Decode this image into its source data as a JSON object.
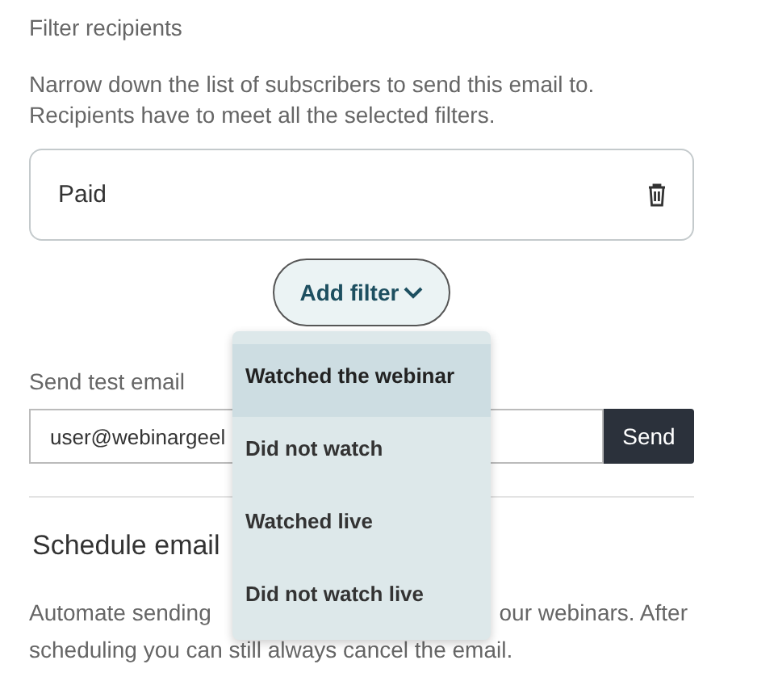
{
  "filter_section": {
    "title": "Filter recipients",
    "description": "Narrow down the list of subscribers to send this email to. Recipients have to meet all the selected filters.",
    "filters": [
      {
        "label": "Paid"
      }
    ],
    "add_filter_button": "Add filter",
    "dropdown": [
      {
        "label": "Watched the webinar",
        "selected": true
      },
      {
        "label": "Did not watch",
        "selected": false
      },
      {
        "label": "Watched live",
        "selected": false
      },
      {
        "label": "Did not watch live",
        "selected": false
      }
    ]
  },
  "test_email": {
    "label": "Send test email",
    "value": "user@webinargeel",
    "button": "Send"
  },
  "schedule": {
    "title": "Schedule email",
    "description_start": "Automate sending",
    "description_end": "our webinars. After",
    "description_line_2": "scheduling you can still always cancel the email."
  }
}
